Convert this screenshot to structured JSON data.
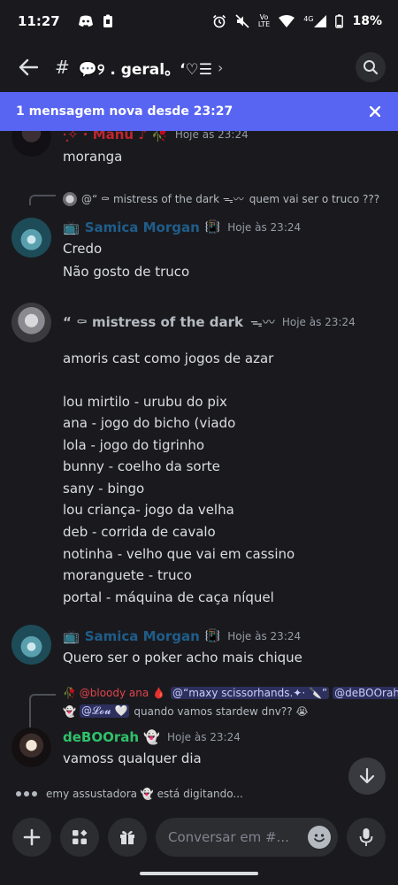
{
  "status": {
    "time": "11:27",
    "battery": "18%",
    "net": "4G"
  },
  "header": {
    "hash": "#",
    "title": "💬୨ . geral。‘♡☰",
    "chevron": "›"
  },
  "banner": {
    "text": "1 mensagem nova desde 23:27"
  },
  "messages": {
    "m0": {
      "user": "·̩͙✧ · Manu ♪ 🥀",
      "time": "Hoje às 23:24",
      "lines": [
        "moranga"
      ]
    },
    "m1": {
      "reply_user": "@“ ⚰ mistress of the dark ᯓ〰",
      "reply_text": "quem vai ser o truco ???",
      "icon": "📺",
      "user": "Samica Morgan",
      "badge": "📳",
      "time": "Hoje às 23:24",
      "lines": [
        "Credo",
        "Não gosto de truco"
      ]
    },
    "m2": {
      "user": "“ ⚰ mistress of the dark",
      "badge": "ᯓ〰",
      "time": "Hoje às 23:24",
      "lines": [
        "amoris cast como jogos de azar",
        "lou mirtilo - urubu do pix",
        "ana - jogo do bicho (viado",
        "lola - jogo do tigrinho",
        "bunny - coelho da sorte",
        "sany - bingo",
        "lou criança- jogo da velha",
        "deb - corrida de cavalo",
        "notinha - velho que vai em cassino",
        "moranguete - truco",
        "portal - máquina de caça níquel"
      ]
    },
    "m3": {
      "icon": "📺",
      "user": "Samica Morgan",
      "badge": "📳",
      "time": "Hoje às 23:24",
      "lines": [
        "Quero ser o poker acho mais chique"
      ]
    },
    "m4": {
      "reply_user": "🥀 @bloody ana 🩸",
      "reply_mention1": "@“maxy scissorhands.✦· 🔪”",
      "reply_mention2": "@deBOOrah",
      "reply_line2_prefix": "👻",
      "reply_mention3": "@𝓛𝓸𝓾 🤍",
      "reply_text": "quando vamos stardew dnv?? 😭",
      "user": "deBOOrah 👻",
      "time": "Hoje às 23:24",
      "lines": [
        "vamoss qualquer dia"
      ]
    }
  },
  "typing": {
    "text": "emy assustadora 👻 está digitando..."
  },
  "composer": {
    "placeholder": "Conversar em #..."
  },
  "colors": {
    "accent": "#5865f2",
    "samica": "#1f5d8a",
    "mistress": "#b5bac1",
    "deboorah": "#2fc26b",
    "manu": "#c0262d"
  }
}
